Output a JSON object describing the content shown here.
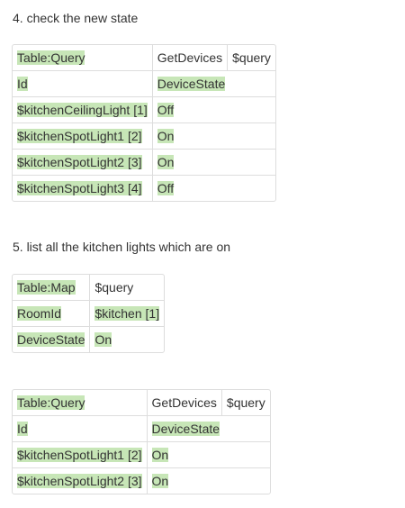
{
  "step4": {
    "heading": "4. check the new state",
    "table": {
      "header": [
        "Table:Query",
        "GetDevices",
        "$query"
      ],
      "columns": [
        "Id",
        "DeviceState"
      ],
      "rows": [
        [
          "$kitchenCeilingLight [1]",
          "Off"
        ],
        [
          "$kitchenSpotLight1 [2]",
          "On"
        ],
        [
          "$kitchenSpotLight2 [3]",
          "On"
        ],
        [
          "$kitchenSpotLight3 [4]",
          "Off"
        ]
      ]
    }
  },
  "step5": {
    "heading": "5. list all the kitchen lights which are on",
    "map_table": {
      "header": [
        "Table:Map",
        "$query"
      ],
      "rows": [
        [
          "RoomId",
          "$kitchen [1]"
        ],
        [
          "DeviceState",
          "On"
        ]
      ]
    },
    "query_table": {
      "header": [
        "Table:Query",
        "GetDevices",
        "$query"
      ],
      "columns": [
        "Id",
        "DeviceState"
      ],
      "rows": [
        [
          "$kitchenSpotLight1 [2]",
          "On"
        ],
        [
          "$kitchenSpotLight2 [3]",
          "On"
        ]
      ]
    }
  },
  "colors": {
    "highlight": "#c7e6b7",
    "border": "#dddddd",
    "text": "#333333"
  }
}
